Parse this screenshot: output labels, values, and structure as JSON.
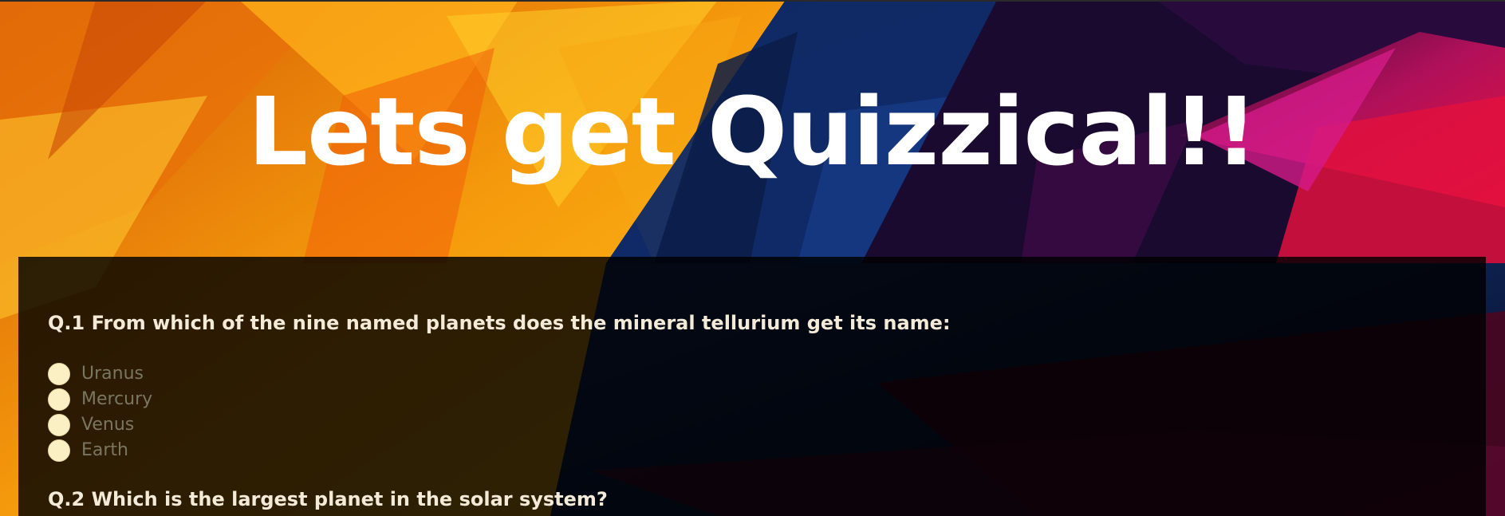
{
  "page": {
    "title": "Lets get Quizzical!!"
  },
  "quiz": {
    "questions": [
      {
        "text": "Q.1 From which of the nine named planets does the mineral tellurium get its name:",
        "options": [
          "Uranus",
          "Mercury",
          "Venus",
          "Earth"
        ]
      },
      {
        "text": "Q.2 Which is the largest planet in the solar system?"
      }
    ]
  },
  "colors": {
    "radio_fill": "#fbf0c4",
    "question_text": "#f3ead8",
    "option_text": "#7a7662",
    "panel_bg": "rgba(0,0,0,0.82)"
  }
}
